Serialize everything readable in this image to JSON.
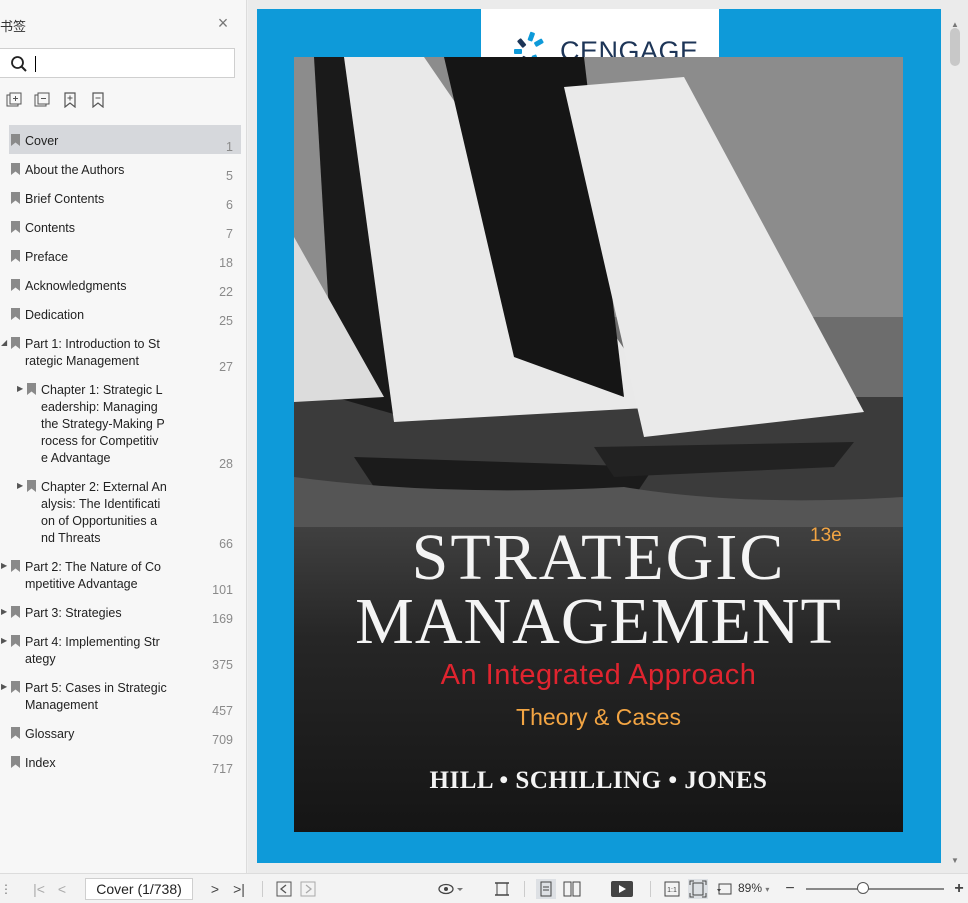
{
  "sidebar": {
    "title": "书签",
    "search": {
      "value": "",
      "placeholder": ""
    },
    "items": [
      {
        "label": "Cover",
        "page": "1",
        "selected": true,
        "expandable": false,
        "level": 0
      },
      {
        "label": "About the Authors",
        "page": "5",
        "level": 0
      },
      {
        "label": "Brief Contents",
        "page": "6",
        "level": 0
      },
      {
        "label": "Contents",
        "page": "7",
        "level": 0
      },
      {
        "label": "Preface",
        "page": "18",
        "level": 0
      },
      {
        "label": "Acknowledgments",
        "page": "22",
        "level": 0
      },
      {
        "label": "Dedication",
        "page": "25",
        "level": 0
      },
      {
        "label": "Part 1: Introduction to St\nrategic Management",
        "page": "27",
        "level": 0,
        "expanded": true
      },
      {
        "label": "Chapter 1: Strategic L\neadership: Managing\nthe Strategy-Making P\nrocess for Competitiv\ne Advantage",
        "page": "28",
        "level": 1
      },
      {
        "label": "Chapter 2: External An\nalysis: The Identificati\non of Opportunities a\nnd Threats",
        "page": "66",
        "level": 1
      },
      {
        "label": "Part 2: The Nature of Co\nmpetitive Advantage",
        "page": "101",
        "level": 0
      },
      {
        "label": "Part 3: Strategies",
        "page": "169",
        "level": 0
      },
      {
        "label": "Part 4: Implementing Str\nategy",
        "page": "375",
        "level": 0
      },
      {
        "label": "Part 5: Cases in Strategic\nManagement",
        "page": "457",
        "level": 0
      },
      {
        "label": "Glossary",
        "page": "709",
        "level": 0
      },
      {
        "label": "Index",
        "page": "717",
        "level": 0
      }
    ]
  },
  "cover": {
    "publisher": "CENGAGE",
    "edition": "13e",
    "title_line1": "STRATEGIC",
    "title_line2": "MANAGEMENT",
    "subtitle": "An Integrated Approach",
    "subsubtitle": "Theory & Cases",
    "authors": "HILL • SCHILLING • JONES"
  },
  "statusbar": {
    "page_field": "Cover (1/738)",
    "zoom": "89%",
    "zoom_fraction": 0.41
  },
  "colors": {
    "page_frame": "#0e9ad9",
    "subtitle_red": "#e0242f",
    "accent_orange": "#f3a543",
    "logo_navy": "#1d3557"
  }
}
